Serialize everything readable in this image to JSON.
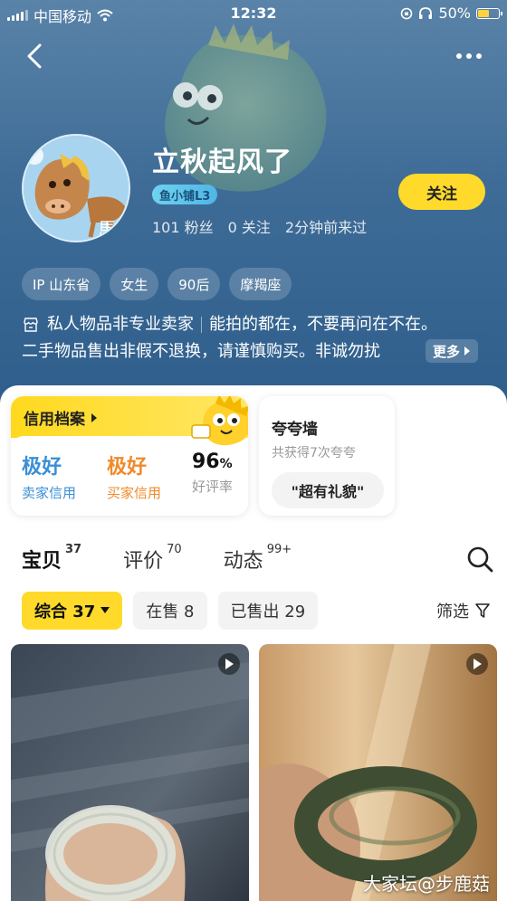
{
  "status_bar": {
    "carrier": "中国移动",
    "time": "12:32",
    "battery": "50%",
    "battery_level": 0.5
  },
  "profile": {
    "username": "立秋起风了",
    "shop_badge": "鱼小铺L3",
    "followers": "101 粉丝",
    "following": "0 关注",
    "last_seen": "2分钟前来过",
    "follow_label": "关注",
    "tags": [
      "IP 山东省",
      "女生",
      "90后",
      "摩羯座"
    ],
    "bio_line1_a": "私人物品非专业卖家",
    "bio_line1_b": "能拍的都在，不要再问在不在。",
    "bio_line2": "二手物品售出非假不退换，请谨慎购买。非诚勿扰",
    "more_label": "更多"
  },
  "credit": {
    "title": "信用档案",
    "seller_value": "极好",
    "seller_label": "卖家信用",
    "buyer_value": "极好",
    "buyer_label": "买家信用",
    "rating_value": "96",
    "rating_unit": "%",
    "rating_label": "好评率"
  },
  "praise": {
    "title": "夸夸墙",
    "subtitle": "共获得7次夸夸",
    "chip": "\"超有礼貌\""
  },
  "tabs": [
    {
      "label": "宝贝",
      "count": "37"
    },
    {
      "label": "评价",
      "count": "70"
    },
    {
      "label": "动态",
      "count": "99+"
    }
  ],
  "filters": {
    "sort": "综合 37",
    "on_sale": "在售 8",
    "sold": "已售出 29",
    "filter_label": "筛选"
  },
  "watermark": "大家坛@步鹿菇",
  "colors": {
    "accent": "#ffda2b",
    "hero": "#3e6c97",
    "seller_credit": "#3a8fd6",
    "buyer_credit": "#f08a2a"
  }
}
